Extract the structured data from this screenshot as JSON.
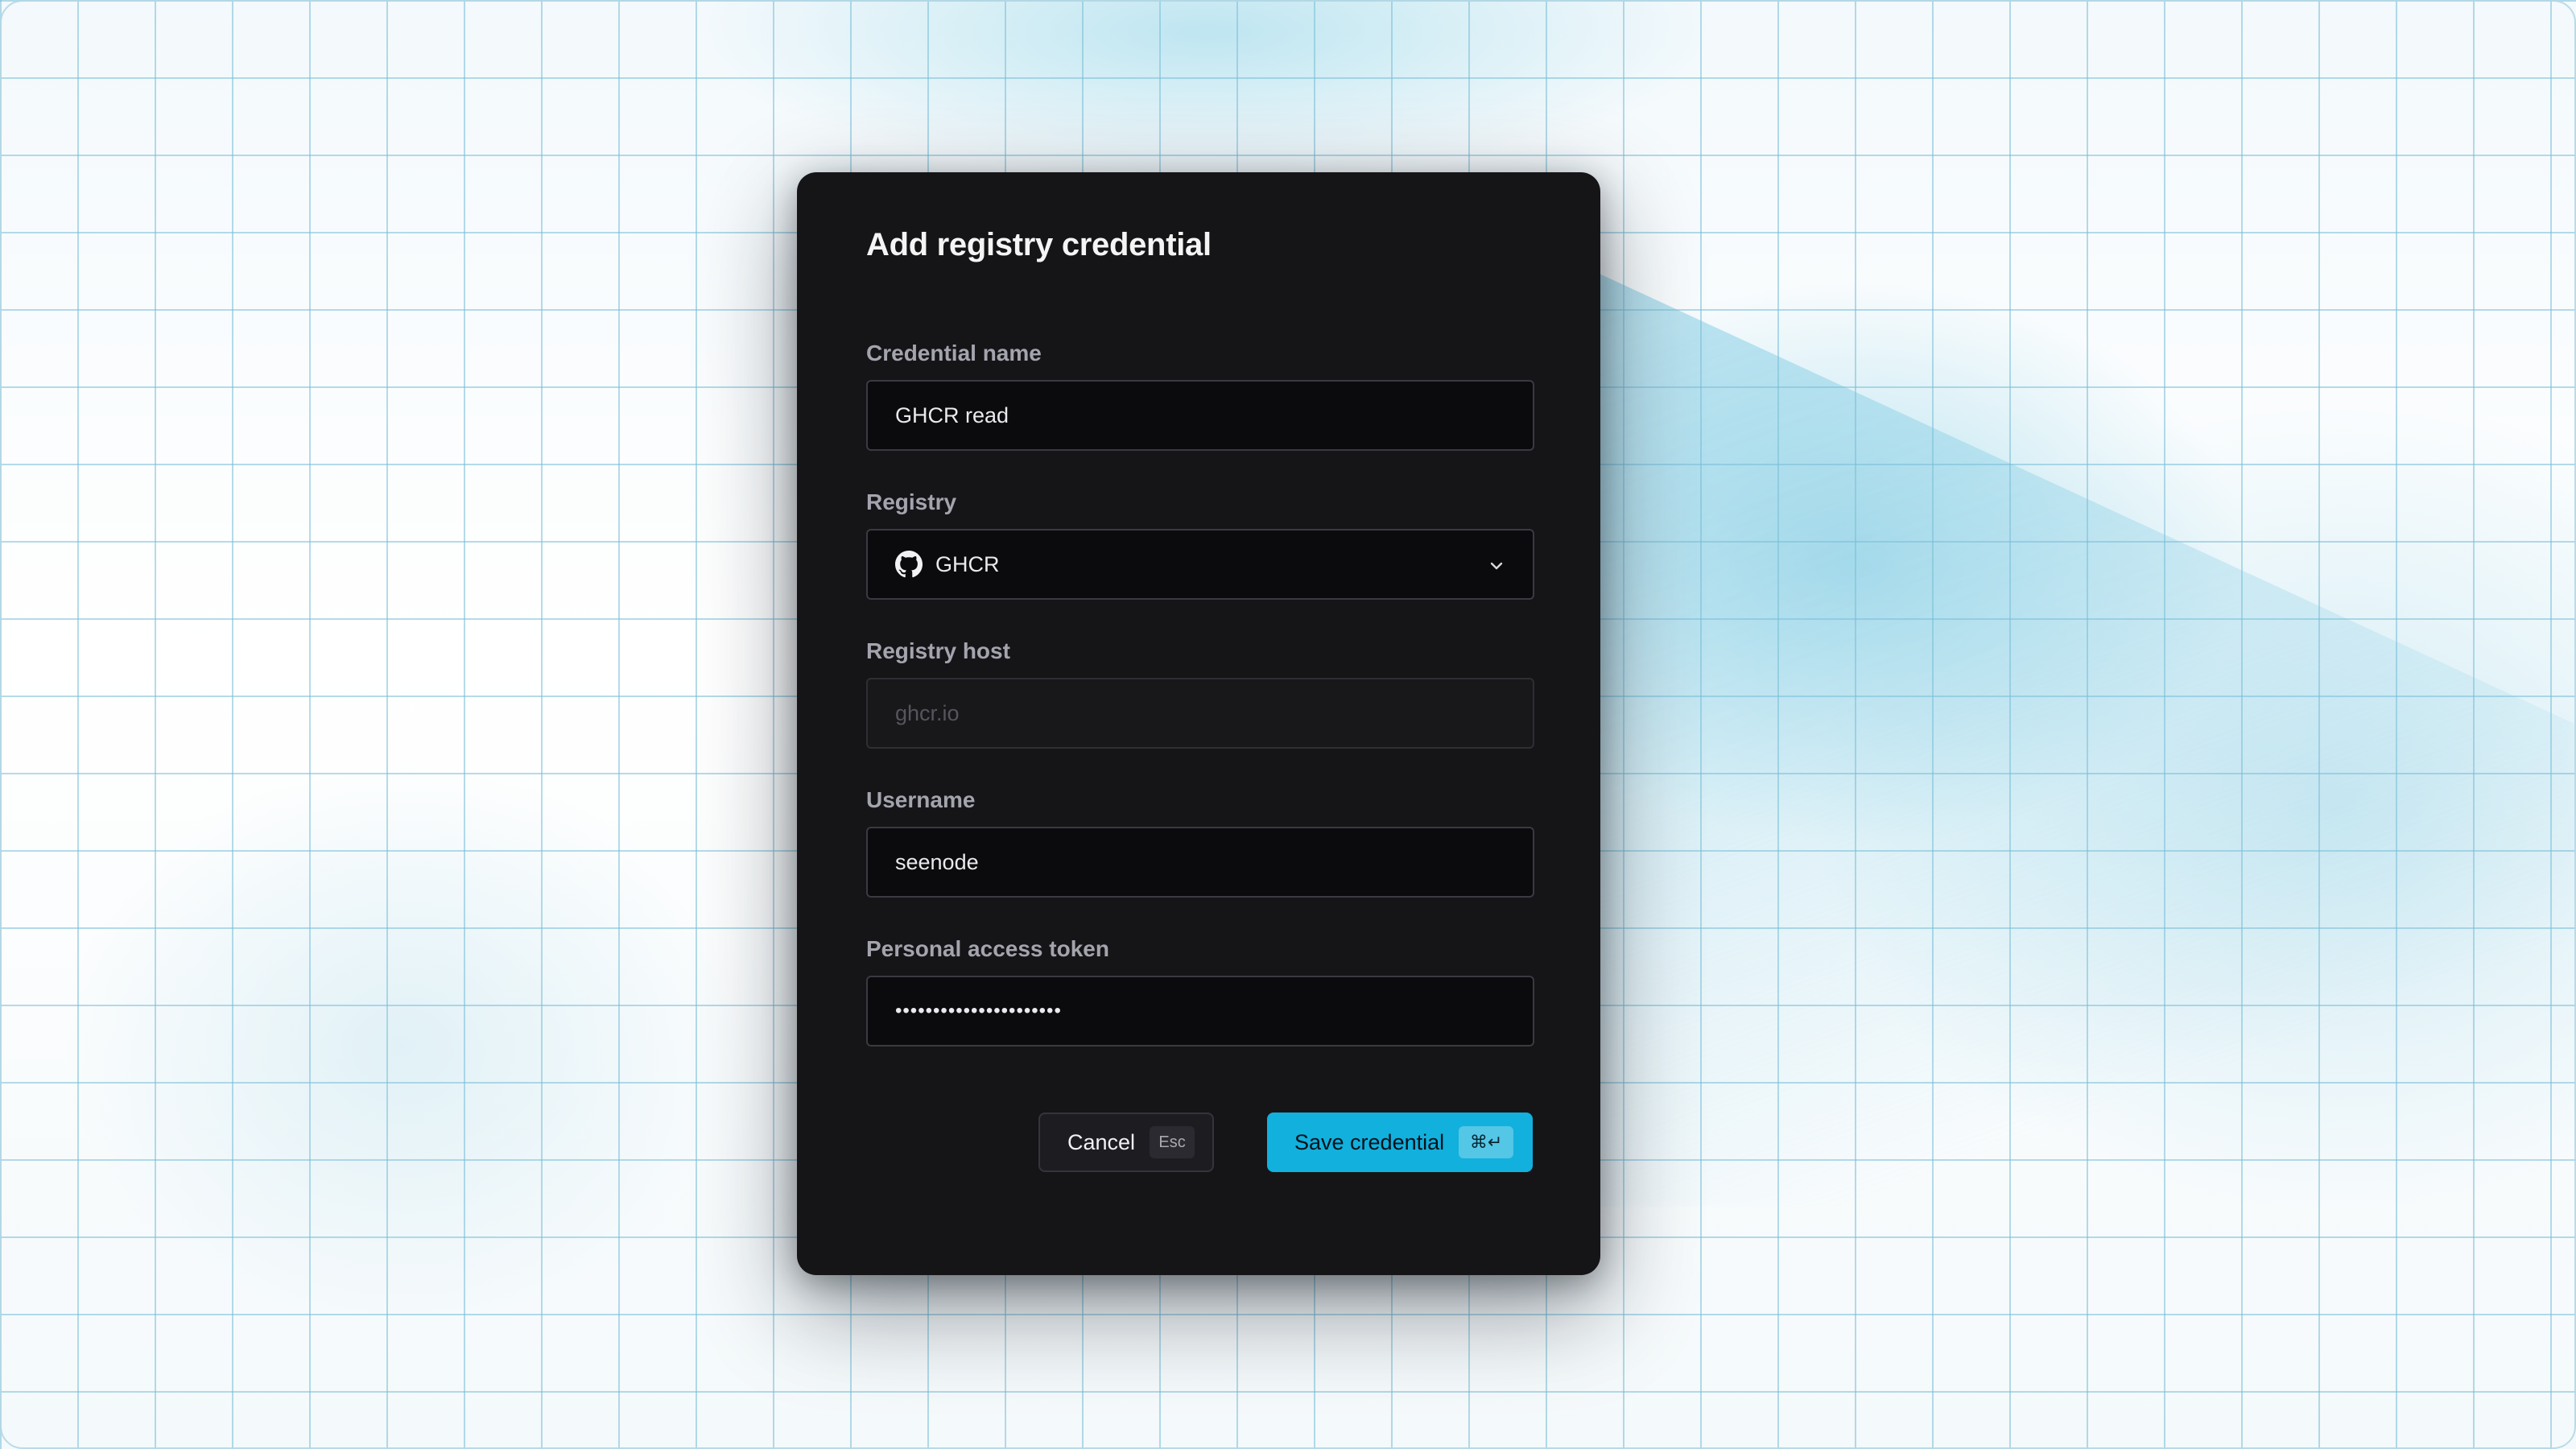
{
  "colors": {
    "modal_background": "#151518",
    "accent": "#12b0dd",
    "input_background": "#0b0b0d",
    "label_color": "#a4a4ae"
  },
  "dialog": {
    "title": "Add registry credential",
    "fields": {
      "credential_name": {
        "label": "Credential name",
        "value": "GHCR read"
      },
      "registry": {
        "label": "Registry",
        "value": "GHCR",
        "icon": "github-icon"
      },
      "registry_host": {
        "label": "Registry host",
        "placeholder": "ghcr.io"
      },
      "username": {
        "label": "Username",
        "value": "seenode"
      },
      "token": {
        "label": "Personal access token",
        "value": "••••••••••••••••••••••"
      }
    },
    "actions": {
      "cancel_label": "Cancel",
      "cancel_shortcut": "Esc",
      "save_label": "Save credential",
      "save_shortcut": "⌘↵"
    }
  }
}
